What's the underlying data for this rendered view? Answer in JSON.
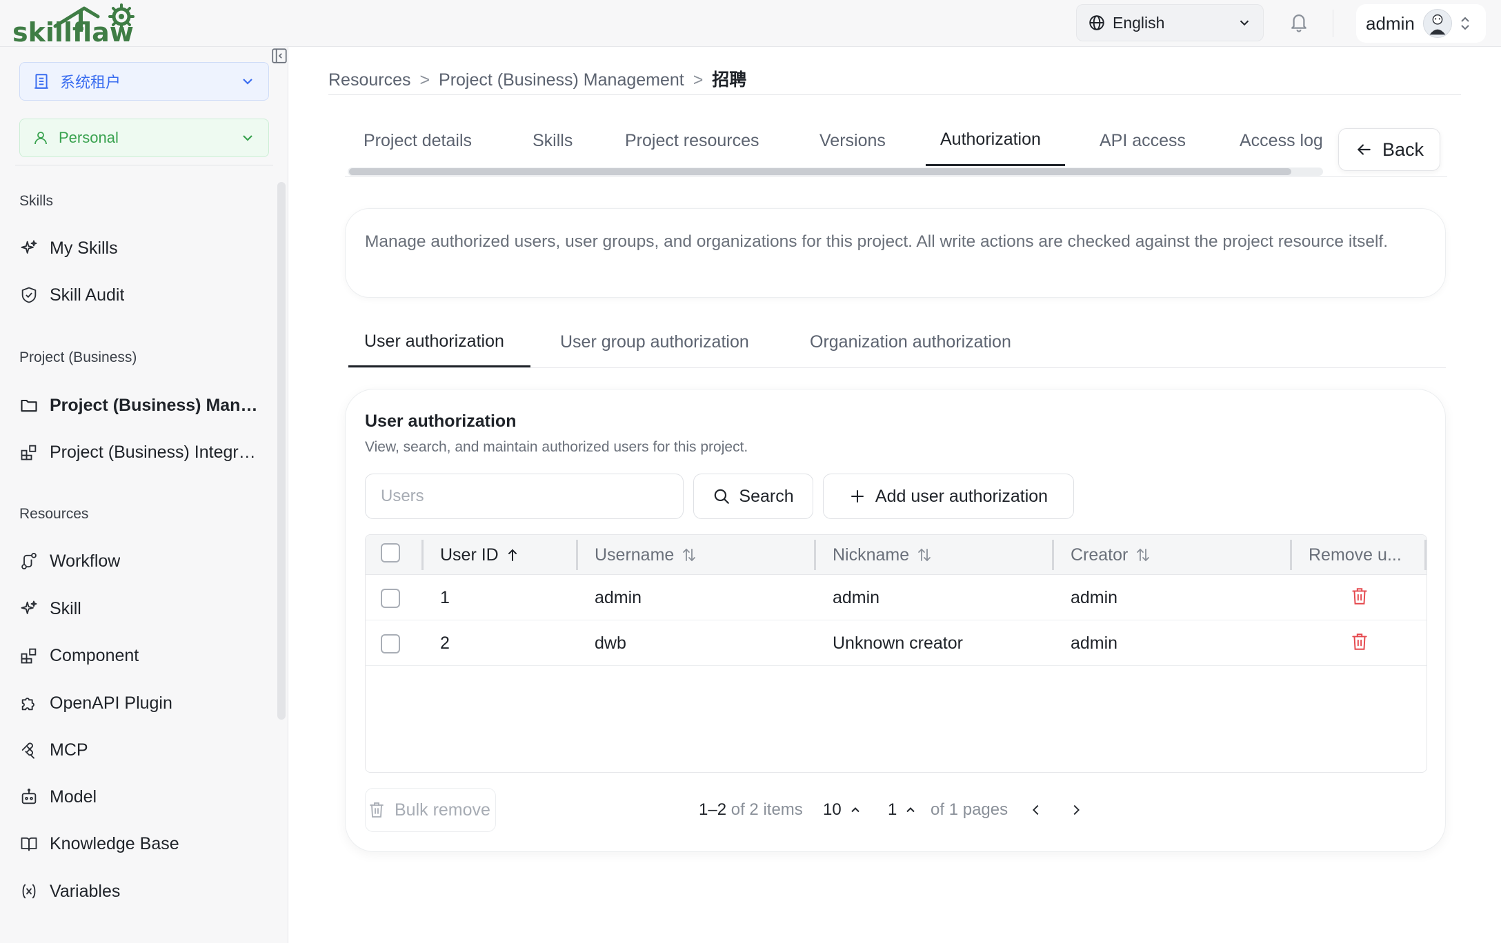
{
  "app": {
    "logo_text": "skillflaw",
    "language": "English",
    "user": "admin"
  },
  "sidebar": {
    "tenant": "系统租户",
    "workspace": "Personal",
    "sections": [
      {
        "title": "Skills",
        "items": [
          "My Skills",
          "Skill Audit"
        ]
      },
      {
        "title": "Project (Business)",
        "items": [
          "Project (Business) Management",
          "Project (Business) Integration"
        ]
      },
      {
        "title": "Resources",
        "items": [
          "Workflow",
          "Skill",
          "Component",
          "OpenAPI Plugin",
          "MCP",
          "Model",
          "Knowledge Base",
          "Variables"
        ]
      }
    ]
  },
  "breadcrumb": {
    "items": [
      "Resources",
      "Project (Business) Management"
    ],
    "separator": ">",
    "current": "招聘"
  },
  "tabs": {
    "items": [
      "Project details",
      "Skills",
      "Project resources",
      "Versions",
      "Authorization",
      "API access",
      "Access logs"
    ],
    "active": "Authorization",
    "back_label": "Back"
  },
  "info_text": "Manage authorized users, user groups, and organizations for this project. All write actions are checked against the project resource itself.",
  "subtabs": {
    "items": [
      "User authorization",
      "User group authorization",
      "Organization authorization"
    ],
    "active": "User authorization"
  },
  "user_auth": {
    "title": "User authorization",
    "subtitle": "View, search, and maintain authorized users for this project.",
    "search_placeholder": "Users",
    "search_value": "",
    "search_label": "Search",
    "add_label": "Add user authorization",
    "columns": [
      "User ID",
      "Username",
      "Nickname",
      "Creator",
      "Remove u..."
    ],
    "rows": [
      {
        "id": "1",
        "username": "admin",
        "nickname": "admin",
        "creator": "admin"
      },
      {
        "id": "2",
        "username": "dwb",
        "nickname": "Unknown creator",
        "creator": "admin"
      }
    ],
    "bulk_remove_label": "Bulk remove",
    "pagination": {
      "range": "1–2",
      "of_text": "of",
      "total": "2",
      "items_text": "items",
      "page_size": "10",
      "page": "1",
      "of_pages_prefix": "of",
      "page_count": "1",
      "pages_text": "pages"
    }
  },
  "colors": {
    "accent_blue": "#3a6df0",
    "accent_green": "#39a24f",
    "danger_red": "#e5484d",
    "logo_green": "#3f7d45"
  }
}
